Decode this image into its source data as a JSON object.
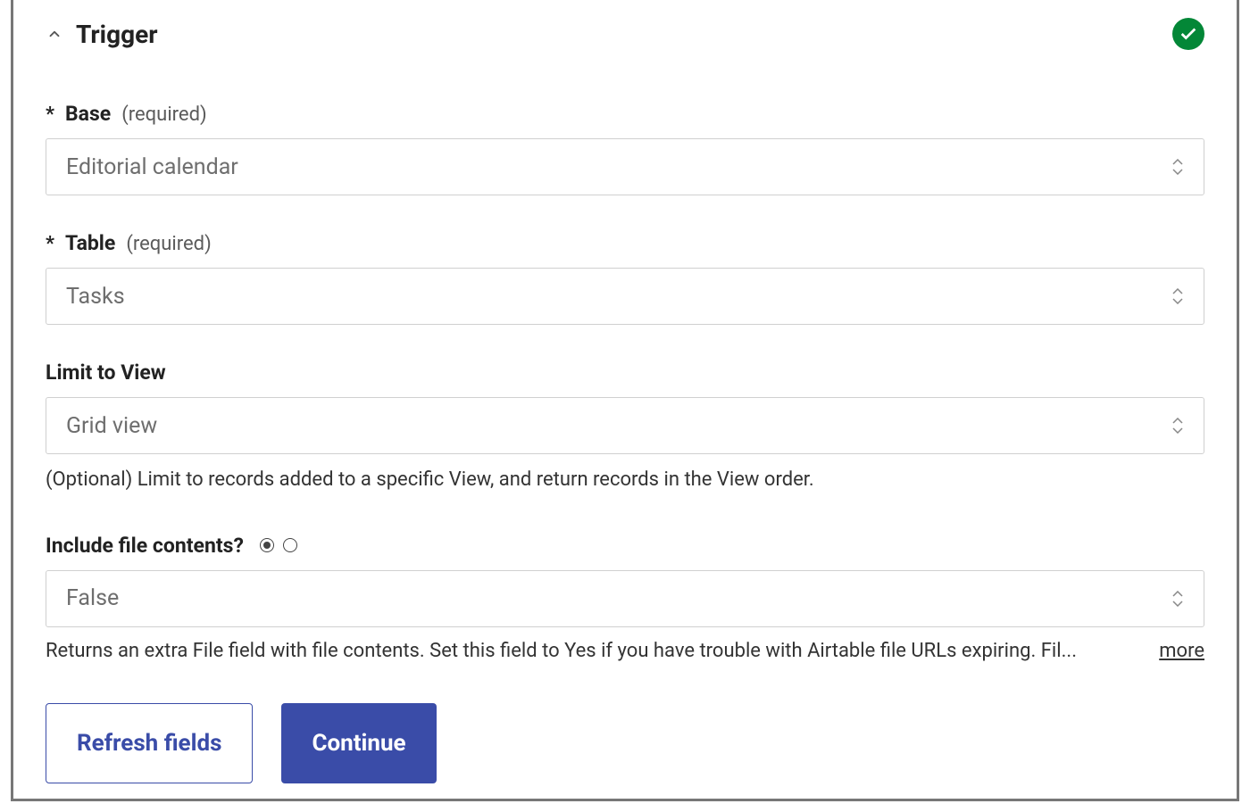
{
  "header": {
    "title": "Trigger"
  },
  "fields": {
    "base": {
      "label": "Base",
      "required_tag": "(required)",
      "value": "Editorial calendar"
    },
    "table": {
      "label": "Table",
      "required_tag": "(required)",
      "value": "Tasks"
    },
    "limit_view": {
      "label": "Limit to View",
      "value": "Grid view",
      "help": "(Optional) Limit to records added to a specific View, and return records in the View order."
    },
    "include_files": {
      "label": "Include file contents?",
      "value": "False",
      "help": "Returns an extra File field with file contents. Set this field to Yes if you have trouble with Airtable file URLs expiring. Fil...",
      "more": "more"
    }
  },
  "buttons": {
    "refresh": "Refresh fields",
    "continue": "Continue"
  }
}
